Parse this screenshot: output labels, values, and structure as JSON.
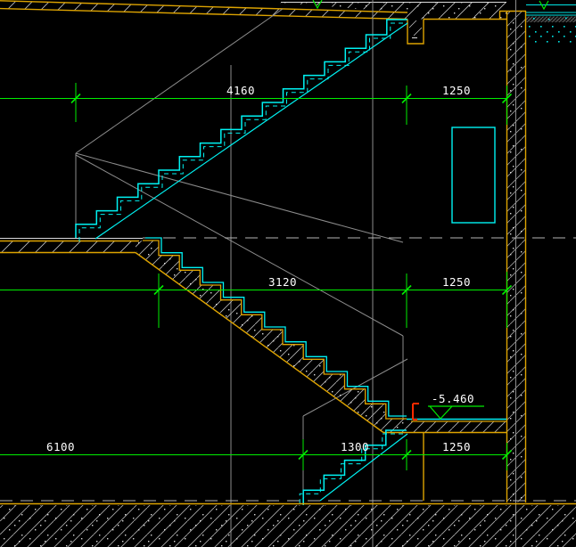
{
  "drawing": {
    "type": "stair-section",
    "dim_rows": {
      "top": {
        "run": "4160",
        "landing": "1250"
      },
      "middle": {
        "run": "3120",
        "landing": "1250"
      },
      "bottom": {
        "left": "6100",
        "run": "1300",
        "landing": "1250"
      }
    },
    "level_marker": {
      "value": "-5.460"
    },
    "colors": {
      "background": "#000000",
      "stairs": "#00f2f2",
      "structure": "#dda300",
      "dimensions": "#00ee00",
      "text": "#ffffff",
      "hatch": "#a8a8a8",
      "construction": "#8c8c8c",
      "marker": "#ff2a00"
    }
  }
}
